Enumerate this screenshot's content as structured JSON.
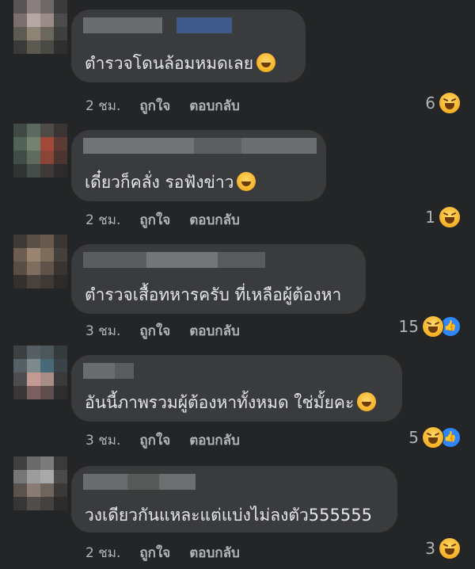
{
  "comments": [
    {
      "text": "ตำรวจโดนล้อมหมดเลย",
      "emoji": "cat-joy-emoji",
      "time": "2 ชม.",
      "like_label": "ถูกใจ",
      "reply_label": "ตอบกลับ",
      "reaction_count": "6",
      "reactions": [
        "haha-icon"
      ]
    },
    {
      "text": "เดี๋ยวก็คลั่ง รอฟังข่าว",
      "emoji": "hand-over-mouth-emoji",
      "time": "2 ชม.",
      "like_label": "ถูกใจ",
      "reply_label": "ตอบกลับ",
      "reaction_count": "1",
      "reactions": [
        "haha-icon"
      ]
    },
    {
      "text": "ตำรวจเสื้อทหารครับ ที่เหลือผู้ต้องหา",
      "emoji": "",
      "time": "3 ชม.",
      "like_label": "ถูกใจ",
      "reply_label": "ตอบกลับ",
      "reaction_count": "15",
      "reactions": [
        "haha-icon",
        "like-icon"
      ]
    },
    {
      "text": "อันนี้ภาพรวมผู้ต้องหาทั้งหมด ใช่มั้ยคะ",
      "emoji": "rofl-emoji",
      "time": "3 ชม.",
      "like_label": "ถูกใจ",
      "reply_label": "ตอบกลับ",
      "reaction_count": "5",
      "reactions": [
        "haha-icon",
        "like-icon"
      ]
    },
    {
      "text": "วงเดียวกันแหละแต่แบ่งไม่ลงตัว555555",
      "emoji": "",
      "time": "2 ชม.",
      "like_label": "ถูกใจ",
      "reply_label": "ตอบกลับ",
      "reaction_count": "3",
      "reactions": [
        "haha-icon"
      ]
    }
  ],
  "colors": {
    "background": "#242526",
    "bubble": "#3a3b3c",
    "text": "#e4e6eb",
    "meta_text": "#b0b3b8",
    "like_blue": "#2d88ff",
    "haha_yellow": "#f7b125"
  }
}
